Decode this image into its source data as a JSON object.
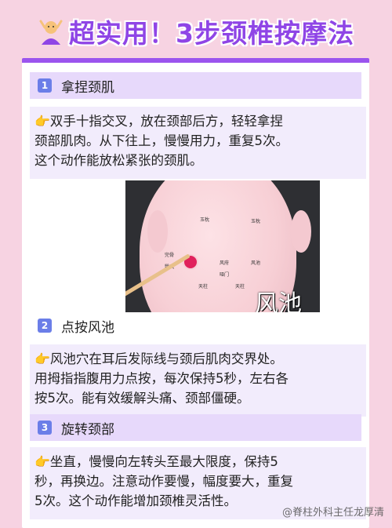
{
  "title": {
    "icon": "massage-person-icon",
    "text": "超实用！3步颈椎按摩法"
  },
  "sections": [
    {
      "number": "1",
      "title": "拿捏颈肌",
      "body_icon": "👉",
      "body": [
        "双手十指交叉，放在颈部后方，轻轻拿捏",
        "颈部肌肉。从下往上，慢慢用力，重复5次。",
        "这个动作能放松紧张的颈肌。"
      ]
    },
    {
      "number": "2",
      "title": "点按风池",
      "body_icon": "👉",
      "body": [
        "风池穴在耳后发际线与颈后肌肉交界处。",
        "用拇指指腹用力点按，每次保持5秒，左右各",
        "按5次。能有效缓解头痛、颈部僵硬。"
      ]
    },
    {
      "number": "3",
      "title": "旋转颈部",
      "body_icon": "👉",
      "body": [
        "坐直，慢慢向左转头至最大限度，保持5",
        "秒，再换边。注意动作要慢，幅度要大，重复",
        "5次。这个动作能增加颈椎灵活性。"
      ]
    }
  ],
  "photo": {
    "acupoint_label": "风池",
    "model_labels": [
      "玉枕",
      "玉枕",
      "风府",
      "风池",
      "哑门",
      "天柱",
      "天柱",
      "完骨",
      "翳风"
    ]
  },
  "watermark": "@脊柱外科主任龙厚清",
  "colors": {
    "background": "#f7d3e2",
    "accent": "#9b54ee",
    "badge": "#6b7ee8",
    "section_bg": "#e7d9fb",
    "text_block_bg": "#f2ecfc",
    "acupoint_dot": "#e0215c"
  }
}
